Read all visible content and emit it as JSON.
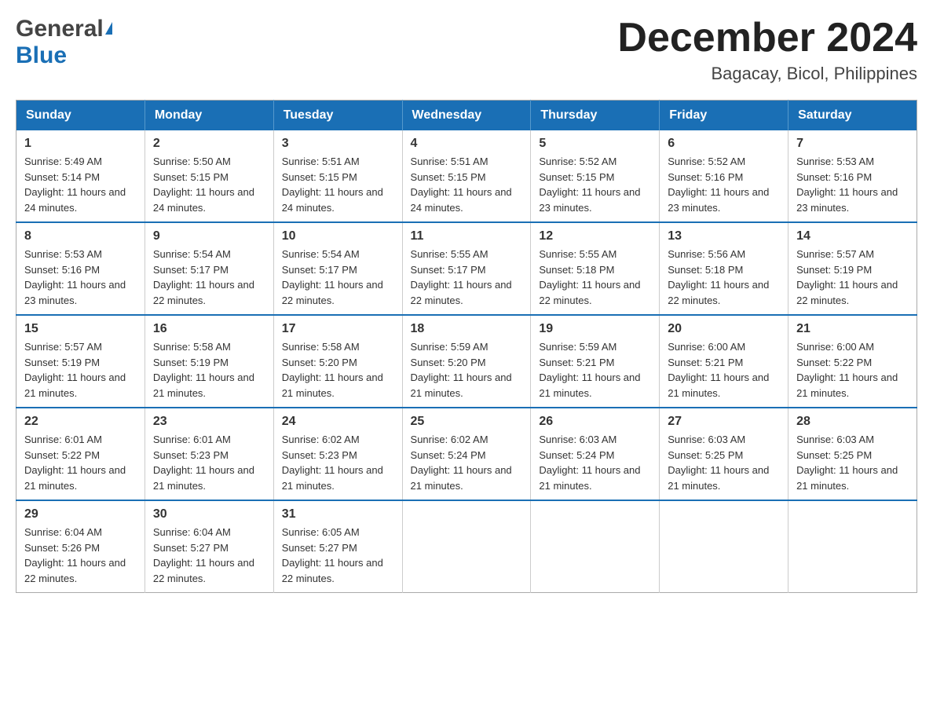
{
  "logo": {
    "general": "General",
    "blue": "Blue"
  },
  "header": {
    "month": "December 2024",
    "location": "Bagacay, Bicol, Philippines"
  },
  "weekdays": [
    "Sunday",
    "Monday",
    "Tuesday",
    "Wednesday",
    "Thursday",
    "Friday",
    "Saturday"
  ],
  "weeks": [
    [
      {
        "day": "1",
        "sunrise": "5:49 AM",
        "sunset": "5:14 PM",
        "daylight": "11 hours and 24 minutes."
      },
      {
        "day": "2",
        "sunrise": "5:50 AM",
        "sunset": "5:15 PM",
        "daylight": "11 hours and 24 minutes."
      },
      {
        "day": "3",
        "sunrise": "5:51 AM",
        "sunset": "5:15 PM",
        "daylight": "11 hours and 24 minutes."
      },
      {
        "day": "4",
        "sunrise": "5:51 AM",
        "sunset": "5:15 PM",
        "daylight": "11 hours and 24 minutes."
      },
      {
        "day": "5",
        "sunrise": "5:52 AM",
        "sunset": "5:15 PM",
        "daylight": "11 hours and 23 minutes."
      },
      {
        "day": "6",
        "sunrise": "5:52 AM",
        "sunset": "5:16 PM",
        "daylight": "11 hours and 23 minutes."
      },
      {
        "day": "7",
        "sunrise": "5:53 AM",
        "sunset": "5:16 PM",
        "daylight": "11 hours and 23 minutes."
      }
    ],
    [
      {
        "day": "8",
        "sunrise": "5:53 AM",
        "sunset": "5:16 PM",
        "daylight": "11 hours and 23 minutes."
      },
      {
        "day": "9",
        "sunrise": "5:54 AM",
        "sunset": "5:17 PM",
        "daylight": "11 hours and 22 minutes."
      },
      {
        "day": "10",
        "sunrise": "5:54 AM",
        "sunset": "5:17 PM",
        "daylight": "11 hours and 22 minutes."
      },
      {
        "day": "11",
        "sunrise": "5:55 AM",
        "sunset": "5:17 PM",
        "daylight": "11 hours and 22 minutes."
      },
      {
        "day": "12",
        "sunrise": "5:55 AM",
        "sunset": "5:18 PM",
        "daylight": "11 hours and 22 minutes."
      },
      {
        "day": "13",
        "sunrise": "5:56 AM",
        "sunset": "5:18 PM",
        "daylight": "11 hours and 22 minutes."
      },
      {
        "day": "14",
        "sunrise": "5:57 AM",
        "sunset": "5:19 PM",
        "daylight": "11 hours and 22 minutes."
      }
    ],
    [
      {
        "day": "15",
        "sunrise": "5:57 AM",
        "sunset": "5:19 PM",
        "daylight": "11 hours and 21 minutes."
      },
      {
        "day": "16",
        "sunrise": "5:58 AM",
        "sunset": "5:19 PM",
        "daylight": "11 hours and 21 minutes."
      },
      {
        "day": "17",
        "sunrise": "5:58 AM",
        "sunset": "5:20 PM",
        "daylight": "11 hours and 21 minutes."
      },
      {
        "day": "18",
        "sunrise": "5:59 AM",
        "sunset": "5:20 PM",
        "daylight": "11 hours and 21 minutes."
      },
      {
        "day": "19",
        "sunrise": "5:59 AM",
        "sunset": "5:21 PM",
        "daylight": "11 hours and 21 minutes."
      },
      {
        "day": "20",
        "sunrise": "6:00 AM",
        "sunset": "5:21 PM",
        "daylight": "11 hours and 21 minutes."
      },
      {
        "day": "21",
        "sunrise": "6:00 AM",
        "sunset": "5:22 PM",
        "daylight": "11 hours and 21 minutes."
      }
    ],
    [
      {
        "day": "22",
        "sunrise": "6:01 AM",
        "sunset": "5:22 PM",
        "daylight": "11 hours and 21 minutes."
      },
      {
        "day": "23",
        "sunrise": "6:01 AM",
        "sunset": "5:23 PM",
        "daylight": "11 hours and 21 minutes."
      },
      {
        "day": "24",
        "sunrise": "6:02 AM",
        "sunset": "5:23 PM",
        "daylight": "11 hours and 21 minutes."
      },
      {
        "day": "25",
        "sunrise": "6:02 AM",
        "sunset": "5:24 PM",
        "daylight": "11 hours and 21 minutes."
      },
      {
        "day": "26",
        "sunrise": "6:03 AM",
        "sunset": "5:24 PM",
        "daylight": "11 hours and 21 minutes."
      },
      {
        "day": "27",
        "sunrise": "6:03 AM",
        "sunset": "5:25 PM",
        "daylight": "11 hours and 21 minutes."
      },
      {
        "day": "28",
        "sunrise": "6:03 AM",
        "sunset": "5:25 PM",
        "daylight": "11 hours and 21 minutes."
      }
    ],
    [
      {
        "day": "29",
        "sunrise": "6:04 AM",
        "sunset": "5:26 PM",
        "daylight": "11 hours and 22 minutes."
      },
      {
        "day": "30",
        "sunrise": "6:04 AM",
        "sunset": "5:27 PM",
        "daylight": "11 hours and 22 minutes."
      },
      {
        "day": "31",
        "sunrise": "6:05 AM",
        "sunset": "5:27 PM",
        "daylight": "11 hours and 22 minutes."
      },
      null,
      null,
      null,
      null
    ]
  ],
  "labels": {
    "sunrise": "Sunrise:",
    "sunset": "Sunset:",
    "daylight": "Daylight:"
  }
}
